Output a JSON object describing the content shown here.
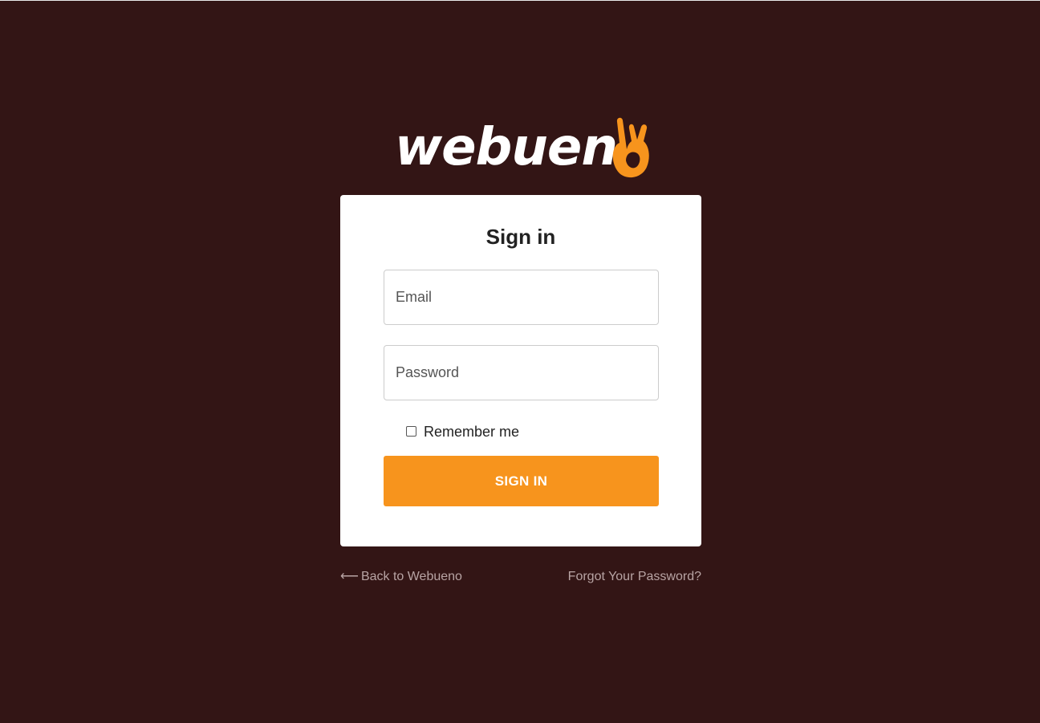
{
  "brand": {
    "logo_text_main": "webuen",
    "logo_text_accent": "o",
    "logo_color": "#ffffff",
    "accent_color": "#f7941d",
    "background_color": "#331515"
  },
  "card": {
    "title": "Sign in"
  },
  "form": {
    "email": {
      "value": "",
      "placeholder": "Email"
    },
    "password": {
      "value": "",
      "placeholder": "Password"
    },
    "remember_label": "Remember me",
    "remember_checked": false,
    "submit_label": "SIGN IN"
  },
  "footer_links": {
    "back_arrow": "⟵",
    "back_label": "Back to Webueno",
    "forgot_label": "Forgot Your Password?"
  },
  "icons": {
    "logo_hand": "ok-hand-icon",
    "back": "arrow-left-icon",
    "checkbox": "checkbox-unchecked-icon"
  }
}
